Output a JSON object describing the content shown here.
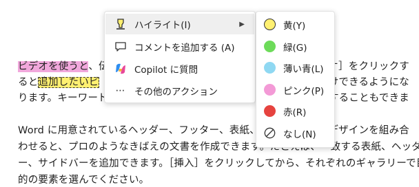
{
  "document": {
    "lines": [
      {
        "pre_highlight": "ビデオを使うと",
        "rest": "、伝",
        "right": "オ］をクリックす"
      },
      {
        "pre": "ると",
        "highlight": "追加したいビ",
        "right": "けできるようにな"
      },
      {
        "text": "ります。キーワード",
        "right": "することもできま"
      },
      {
        "text": "Word に用意されているヘッダー、フッター、表紙、テ",
        "right": "デザインを組み合"
      },
      {
        "text": "わせると、プロのようなきばえの文書を作成できます。たとえば、一致する表紙、ヘッダ"
      },
      {
        "text": "ー、サイドバーを追加できます。［挿入］をクリックしてから、それぞれのギャラリーで目"
      },
      {
        "text": "的の要素を選んでください。"
      }
    ]
  },
  "context_menu": {
    "items": [
      {
        "label": "ハイライト(I)",
        "icon": "highlighter-icon",
        "has_submenu": true
      },
      {
        "label": "コメントを追加する (A)",
        "icon": "comment-icon"
      },
      {
        "label": "Copilot に質問",
        "icon": "copilot-icon"
      },
      {
        "label": "その他のアクション",
        "icon": "more-icon"
      }
    ]
  },
  "highlight_submenu": {
    "items": [
      {
        "label": "黄(Y)",
        "color": "#fff071"
      },
      {
        "label": "緑(G)",
        "color": "#6ddb5a"
      },
      {
        "label": "薄い青(L)",
        "color": "#8fd8f2"
      },
      {
        "label": "ピンク(P)",
        "color": "#f39ad6"
      },
      {
        "label": "赤(R)",
        "color": "#e6433f"
      },
      {
        "label": "なし(N)",
        "icon": "no-highlight-icon"
      }
    ]
  }
}
